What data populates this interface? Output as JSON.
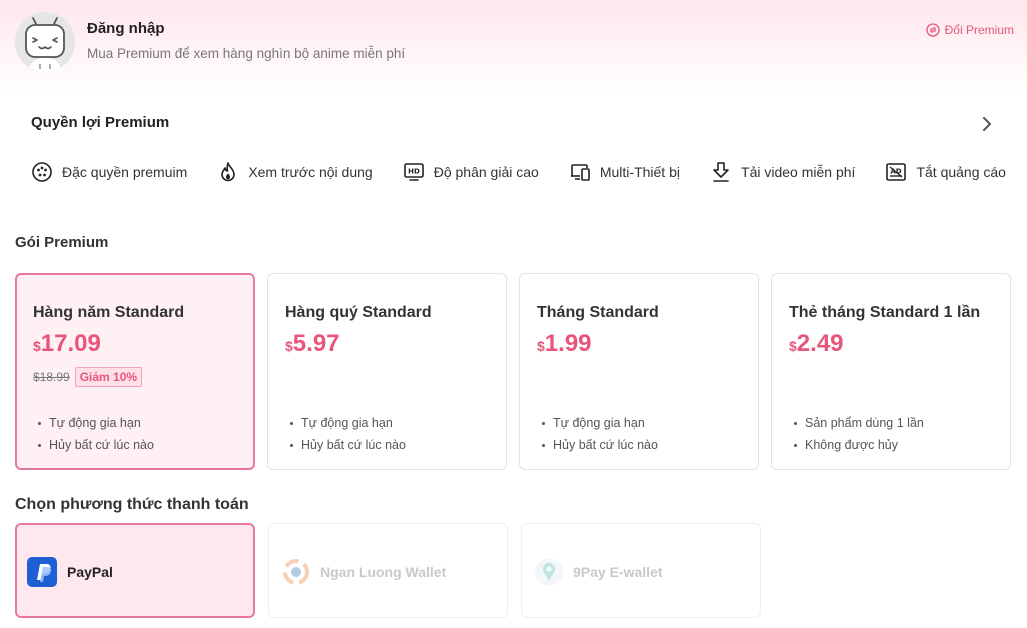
{
  "header": {
    "login_title": "Đăng nhập",
    "login_subtitle": "Mua Premium để xem hàng nghìn bộ anime miễn phí",
    "redeem_label": "Đổi Premium"
  },
  "benefits": {
    "title": "Quyền lợi Premium",
    "items": [
      {
        "label": "Đặc quyền premuim",
        "icon": "premium-badge-icon"
      },
      {
        "label": "Xem trước nội dung",
        "icon": "flame-icon"
      },
      {
        "label": "Độ phân giải cao",
        "icon": "hd-icon"
      },
      {
        "label": "Multi-Thiết bị",
        "icon": "multi-device-icon"
      },
      {
        "label": "Tải video miễn phí",
        "icon": "download-icon"
      },
      {
        "label": "Tắt quảng cáo",
        "icon": "no-ads-icon"
      }
    ]
  },
  "plans": {
    "title": "Gói Premium",
    "items": [
      {
        "name": "Hàng năm Standard",
        "currency": "$",
        "price": "17.09",
        "old_price": "$18.99",
        "discount": "Giảm 10%",
        "features": [
          "Tự động gia hạn",
          "Hủy bất cứ lúc nào"
        ],
        "selected": true
      },
      {
        "name": "Hàng quý Standard",
        "currency": "$",
        "price": "5.97",
        "features": [
          "Tự động gia hạn",
          "Hủy bất cứ lúc nào"
        ],
        "selected": false
      },
      {
        "name": "Tháng Standard",
        "currency": "$",
        "price": "1.99",
        "features": [
          "Tự động gia hạn",
          "Hủy bất cứ lúc nào"
        ],
        "selected": false
      },
      {
        "name": "Thẻ tháng Standard 1 lần",
        "currency": "$",
        "price": "2.49",
        "features": [
          "Sản phẩm dùng 1 lần",
          "Không được hủy"
        ],
        "selected": false
      }
    ]
  },
  "payment": {
    "title": "Chọn phương thức thanh toán",
    "methods": [
      {
        "label": "PayPal",
        "icon": "paypal-icon",
        "selected": true,
        "enabled": true
      },
      {
        "label": "Ngan Luong Wallet",
        "icon": "nganluong-icon",
        "selected": false,
        "enabled": false
      },
      {
        "label": "9Pay E-wallet",
        "icon": "9pay-icon",
        "selected": false,
        "enabled": false
      }
    ]
  },
  "colors": {
    "accent": "#e8557a",
    "selected_border": "#e8799a",
    "paypal_blue": "#1f5fd4"
  }
}
